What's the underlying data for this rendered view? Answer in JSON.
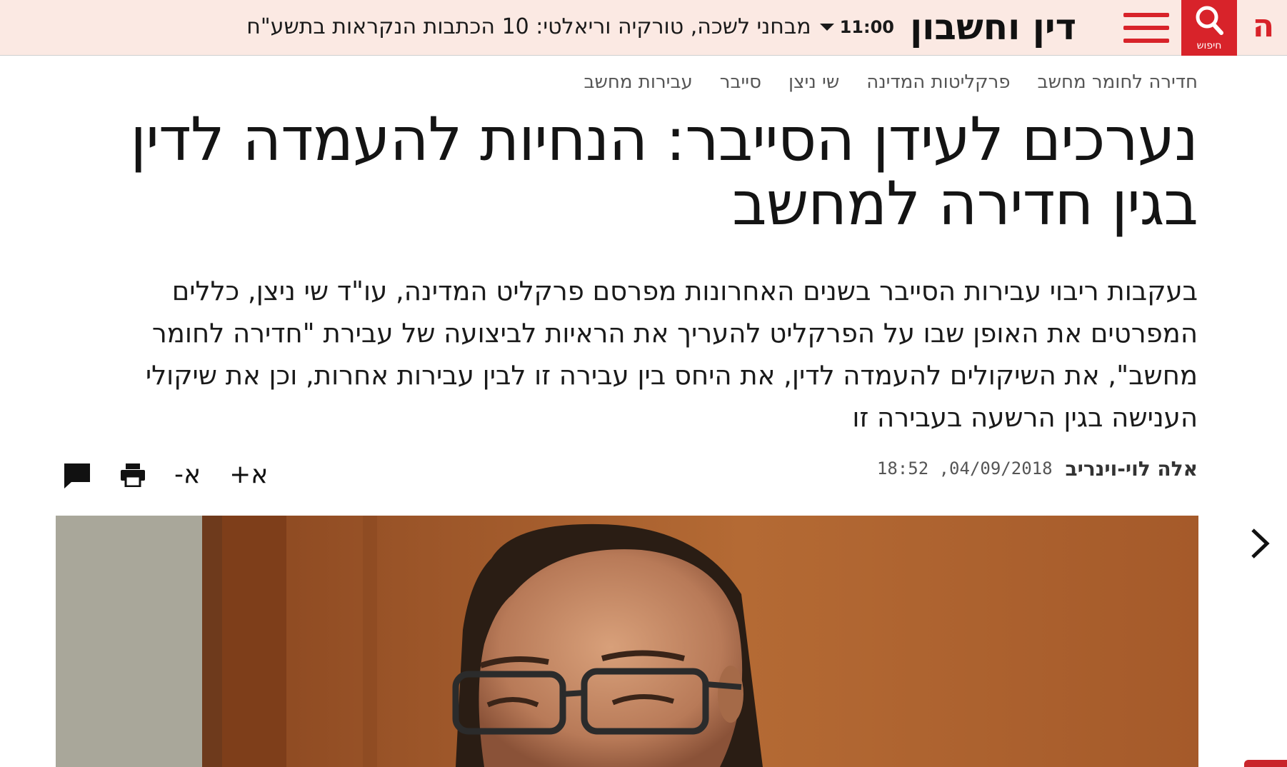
{
  "colors": {
    "brand": "#d8232a",
    "topbar_bg": "#fbe9e3"
  },
  "header": {
    "logo_glyph": "ה",
    "search_label": "חיפוש",
    "section_title": "דין וחשבון",
    "ticker_time": "11:00",
    "ticker_headline": "מבחני לשכה, טורקיה וריאלטי: 10 הכתבות הנקראות בתשע\"ח"
  },
  "tags": [
    "חדירה לחומר מחשב",
    "פרקליטות המדינה",
    "שי ניצן",
    "סייבר",
    "עבירות מחשב"
  ],
  "article": {
    "title": "נערכים לעידן הסייבר: הנחיות להעמדה לדין בגין חדירה למחשב",
    "subtitle": "בעקבות ריבוי עבירות הסייבר בשנים האחרונות מפרסם פרקליט המדינה, עו\"ד שי ניצן, כללים המפרטים את האופן שבו על הפרקליט להעריך את הראיות לביצועה של עבירת \"חדירה לחומר מחשב\", את השיקולים להעמדה לדין, את היחס בין עבירה זו לבין עבירות אחרות, וכן את שיקולי הענישה בגין הרשעה בעבירה זו",
    "author": "אלה לוי-וינריב",
    "date": "18:52 ,04/09/2018"
  },
  "tools": {
    "font_increase": "א+",
    "font_decrease": "א-",
    "print_icon": "print-icon",
    "comment_icon": "comment-icon"
  }
}
